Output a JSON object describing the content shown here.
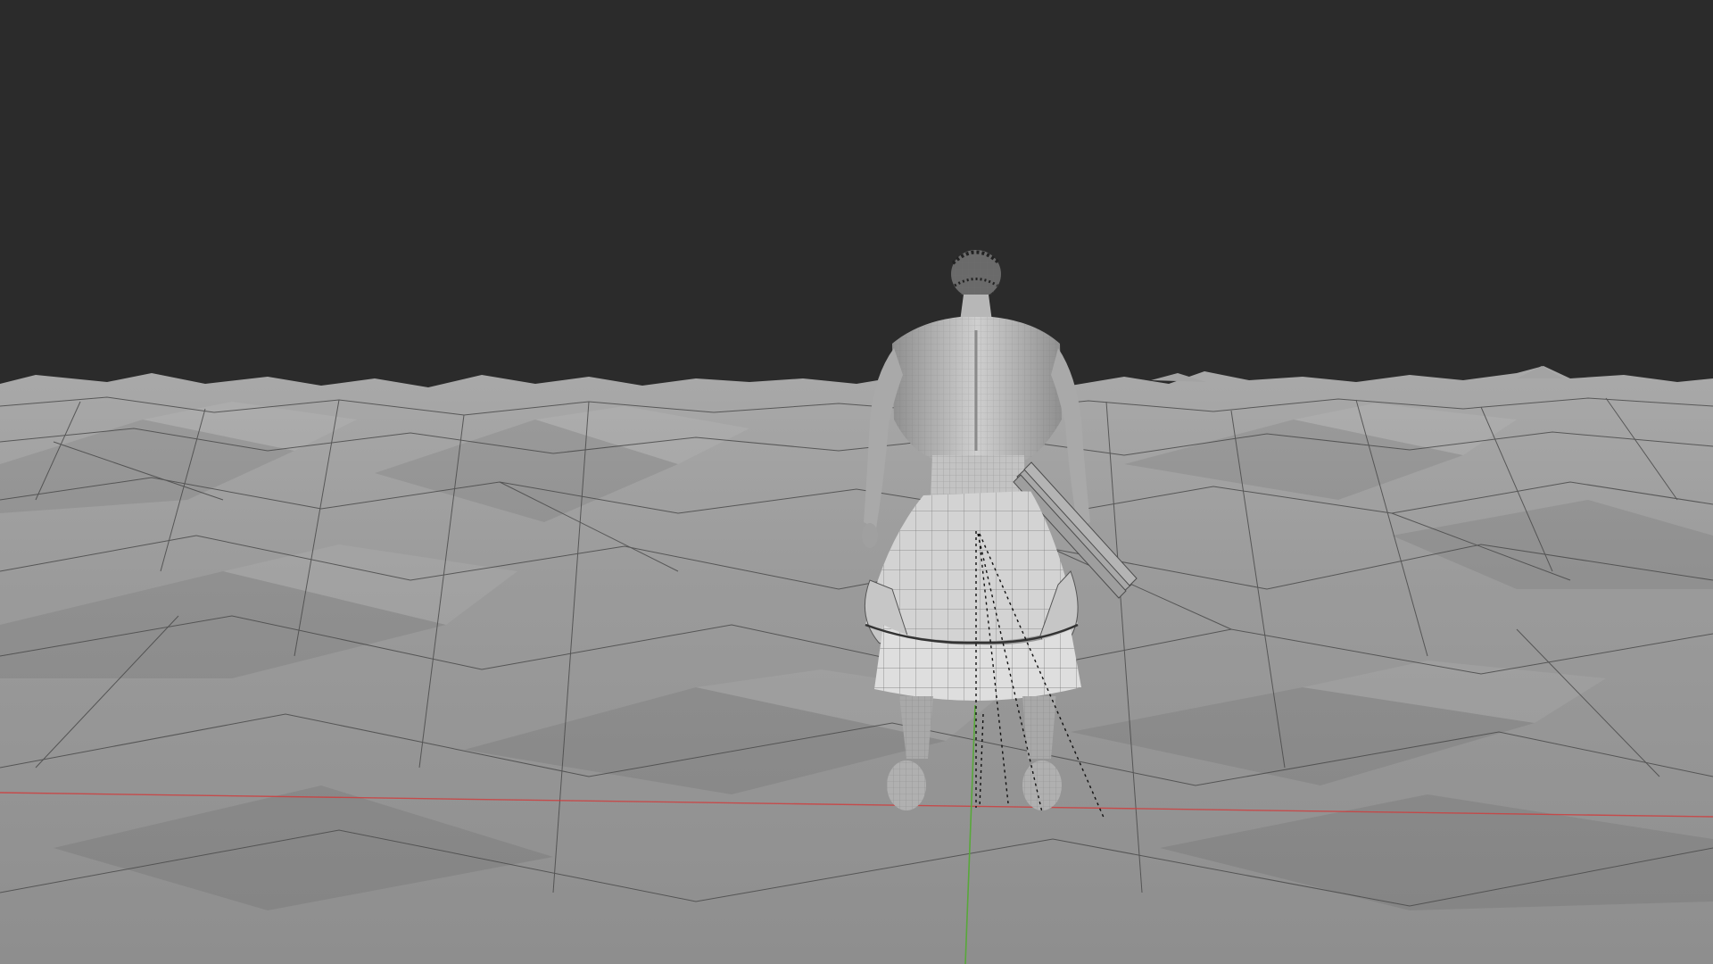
{
  "viewport": {
    "background_color": "#2b2b2b",
    "terrain_color": "#9a9a9a",
    "wire_color": "#4a4a4a",
    "x_axis_color": "#d23a3a",
    "y_axis_color": "#58a83a",
    "character_color": "#b9b9b9"
  }
}
